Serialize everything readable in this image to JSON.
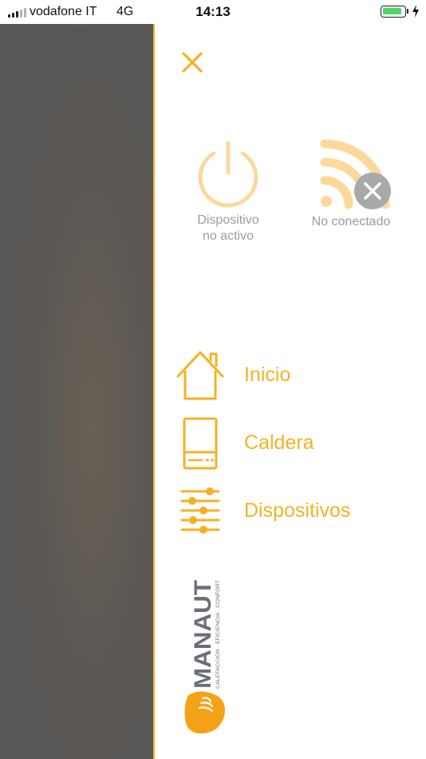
{
  "status_bar": {
    "carrier": "vodafone IT",
    "network": "4G",
    "time": "14:13",
    "battery_color": "#4cd964"
  },
  "drawer": {
    "accent_color": "#f4b223",
    "close_icon": "close-icon",
    "device_status": {
      "power": {
        "icon": "power-icon",
        "label": "Dispositivo\nno activo"
      },
      "wifi": {
        "icon": "wifi-disconnected-icon",
        "label": "No conectado"
      }
    },
    "menu": [
      {
        "icon": "home-icon",
        "label": "Inicio"
      },
      {
        "icon": "boiler-icon",
        "label": "Caldera"
      },
      {
        "icon": "sliders-icon",
        "label": "Dispositivos"
      }
    ],
    "logo": {
      "brand": "MANAUT",
      "tagline": "CALEFACCIÓN · EFICIENCIA · CONFORT"
    }
  }
}
